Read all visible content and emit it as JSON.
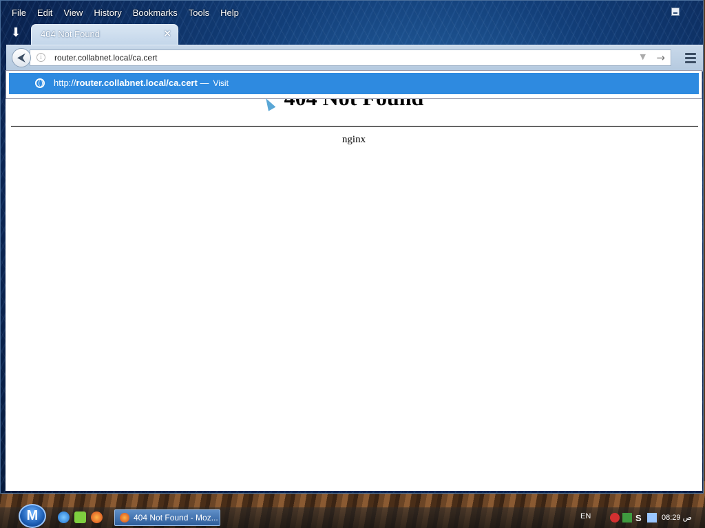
{
  "menu": {
    "file": "File",
    "edit": "Edit",
    "view": "View",
    "history": "History",
    "bookmarks": "Bookmarks",
    "tools": "Tools",
    "help": "Help"
  },
  "tab": {
    "title": "404 Not Found",
    "close": "×"
  },
  "urlbar": {
    "value": "router.collabnet.local/ca.cert"
  },
  "autocomplete": {
    "prefix": "http://",
    "url_bold": "router.collabnet.local/ca.cert",
    "separator": "—",
    "action": "Visit"
  },
  "page": {
    "heading": "404 Not Found",
    "server": "nginx"
  },
  "taskbar": {
    "start_label": "M",
    "task_label": "404 Not Found - Moz...",
    "language": "EN",
    "clock": "08:29 ص",
    "tray_s": "S"
  },
  "colors": {
    "suggestion_highlight": "#2e8ae0",
    "window_frame": "#123e78"
  }
}
